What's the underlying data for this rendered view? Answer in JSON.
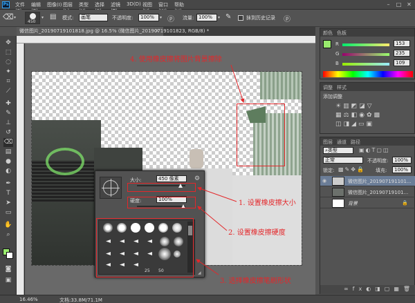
{
  "menubar": {
    "logo": "Ps",
    "items": [
      "文件(F)",
      "编辑(E)",
      "图像(I)",
      "图层(L)",
      "类型(Y)",
      "选择(S)",
      "滤镜(T)",
      "3D(D)",
      "视图(V)",
      "窗口(W)",
      "帮助(H)"
    ]
  },
  "options": {
    "brush_size": "450",
    "mode_label": "模式:",
    "mode_value": "画笔",
    "opacity_label": "不透明度:",
    "opacity_value": "100%",
    "flow_label": "流量:",
    "flow_value": "100%",
    "history_label": "抹到历史记录"
  },
  "document": {
    "tab_title": "微信图片_20190719101818.jpg @ 16.5% (微信图片_20190719101823, RGB/8) *"
  },
  "status": {
    "zoom": "16.46%",
    "doc_info": "文档:33.8M/71.1M"
  },
  "color_panel": {
    "tabs": [
      "颜色",
      "色板"
    ],
    "r_label": "R",
    "r_value": "153",
    "g_label": "G",
    "g_value": "235",
    "b_label": "B",
    "b_value": "109",
    "foreground": "#99eb6d"
  },
  "adjust_panel": {
    "tabs": [
      "调整",
      "样式"
    ],
    "title": "添加调整"
  },
  "layers_panel": {
    "tabs": [
      "图层",
      "通道",
      "路径"
    ],
    "kind_label": "类型",
    "blend_mode": "正常",
    "opacity_label": "不透明度:",
    "opacity_value": "100%",
    "lock_label": "锁定:",
    "fill_label": "填充:",
    "fill_value": "100%",
    "layers": [
      {
        "name": "微信图片_201907191101...",
        "selected": true
      },
      {
        "name": "微信图片_20190719101..."
      },
      {
        "name": "背景"
      }
    ]
  },
  "brush_popup": {
    "size_label": "大小:",
    "size_value": "450 像素",
    "hardness_label": "硬度:",
    "hardness_value": "100%",
    "num_25": "25",
    "num_50": "50"
  },
  "annotations": {
    "a4": "4. 使用橡皮擦将图片背景擦除",
    "a1": "1. 设置橡皮擦大小",
    "a2": "2. 设置橡皮擦硬度",
    "a3": "3. 选择橡皮擦笔刷形状",
    "color": "#e4272a"
  }
}
